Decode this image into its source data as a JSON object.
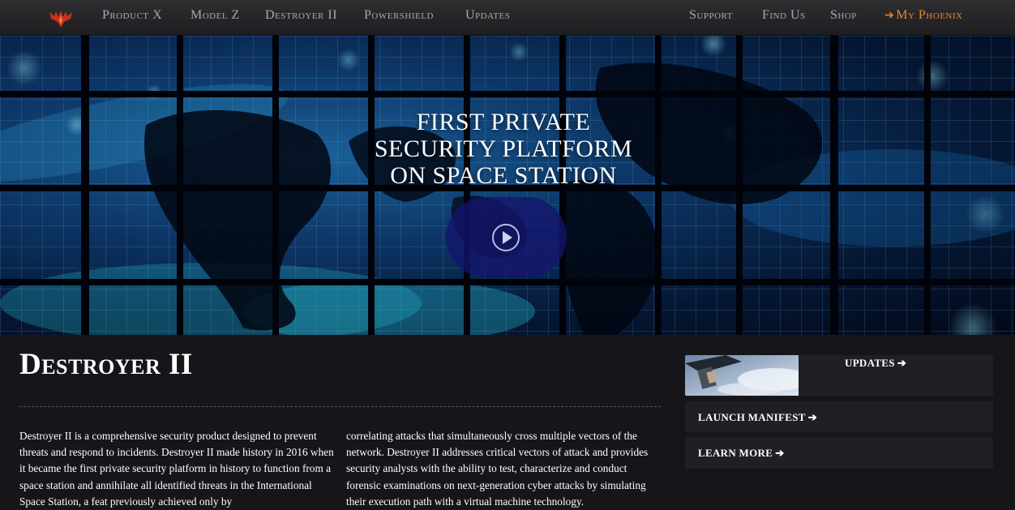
{
  "nav": {
    "left_items": [
      "Product X",
      "Model Z",
      "Destroyer II",
      "Powershield",
      "Updates"
    ],
    "right_items": [
      "Support",
      "Find Us",
      "Shop"
    ],
    "account_label": "My Phoenix",
    "account_icon": "sign-in-icon",
    "logo_icon": "phoenix-logo-icon",
    "accent_color": "#e8852a"
  },
  "hero": {
    "title_lines": [
      "FIRST PRIVATE",
      "SECURITY PLATFORM",
      "ON SPACE STATION"
    ],
    "play_icon": "play-icon"
  },
  "content": {
    "title": "Destroyer II",
    "col1": "Destroyer II is a comprehensive security product designed to prevent threats and respond to incidents. Destroyer II made history in 2016 when it became the first private security platform in history to function from a space station and annihilate all identified threats in the International Space Station, a feat previously achieved only by",
    "col2": "correlating attacks that simultaneously cross multiple vectors of the network. Destroyer II addresses critical vectors of attack and provides security analysts with the ability to test, characterize and conduct forensic examinations on next-generation cyber attacks by simulating their execution path with a virtual machine technology."
  },
  "sidebar": {
    "updates_label": "UPDATES",
    "launch_label": "LAUNCH MANIFEST",
    "learn_label": "LEARN MORE",
    "arrow_icon": "arrow-right-icon"
  }
}
